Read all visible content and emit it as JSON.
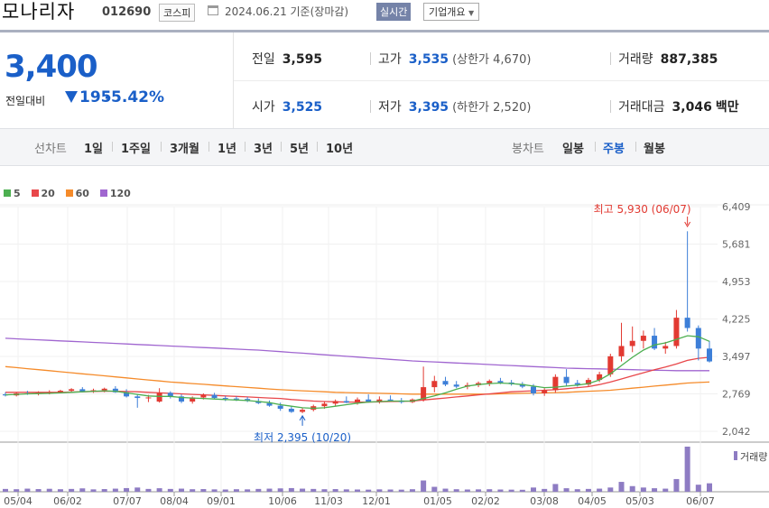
{
  "header": {
    "company": "모나리자",
    "code": "012690",
    "market": "코스피",
    "date": "2024.06.21 기준(장마감)",
    "realtime": "실시간",
    "company_info": "기업개요"
  },
  "price": {
    "current": "3,400",
    "change_label": "전일대비",
    "change": "195",
    "change_pct": "-5.42%"
  },
  "stats": {
    "prev_close_label": "전일",
    "prev_close": "3,595",
    "high_label": "고가",
    "high": "3,535",
    "upper_limit": "(상한가 4,670)",
    "volume_label": "거래량",
    "volume": "887,385",
    "open_label": "시가",
    "open": "3,525",
    "low_label": "저가",
    "low": "3,395",
    "lower_limit": "(하한가 2,520)",
    "amount_label": "거래대금",
    "amount": "3,046",
    "amount_unit": "백만"
  },
  "tabs": {
    "line_label": "선차트",
    "line_tabs": [
      "1일",
      "1주일",
      "3개월",
      "1년",
      "3년",
      "5년",
      "10년"
    ],
    "candle_label": "봉차트",
    "candle_tabs": [
      "일봉",
      "주봉",
      "월봉"
    ],
    "selected": "주봉"
  },
  "colors": {
    "up": "#e23a32",
    "down": "#3d7fd8",
    "ma5": "#4caf50",
    "ma20": "#e8474a",
    "ma60": "#f58b2a",
    "ma120": "#a066d0",
    "volume": "#8e7cc3",
    "accent": "#1a5fc8"
  },
  "chart_data": {
    "type": "candlestick",
    "legend": [
      {
        "name": "5",
        "color": "#4caf50"
      },
      {
        "name": "20",
        "color": "#e8474a"
      },
      {
        "name": "60",
        "color": "#f58b2a"
      },
      {
        "name": "120",
        "color": "#a066d0"
      }
    ],
    "y_ticks": [
      "6,409",
      "5,681",
      "4,953",
      "4,225",
      "3,497",
      "2,769",
      "2,042"
    ],
    "ylim": [
      2042,
      6409
    ],
    "x_ticks": [
      "05/04",
      "06/02",
      "07/07",
      "08/04",
      "09/01",
      "10/06",
      "11/03",
      "12/01",
      "01/05",
      "02/02",
      "03/08",
      "04/05",
      "05/03",
      "06/07"
    ],
    "annotations": {
      "high": {
        "label": "최고 5,930 (06/07)",
        "value": 5930
      },
      "low": {
        "label": "최저 2,395 (10/20)",
        "value": 2395
      }
    },
    "volume_label": "거래량",
    "candles": [
      {
        "o": 2760,
        "h": 2800,
        "l": 2720,
        "c": 2740
      },
      {
        "o": 2740,
        "h": 2800,
        "l": 2720,
        "c": 2780
      },
      {
        "o": 2780,
        "h": 2830,
        "l": 2750,
        "c": 2770
      },
      {
        "o": 2770,
        "h": 2820,
        "l": 2740,
        "c": 2790
      },
      {
        "o": 2790,
        "h": 2840,
        "l": 2760,
        "c": 2800
      },
      {
        "o": 2800,
        "h": 2850,
        "l": 2780,
        "c": 2830
      },
      {
        "o": 2830,
        "h": 2880,
        "l": 2790,
        "c": 2860
      },
      {
        "o": 2860,
        "h": 2900,
        "l": 2800,
        "c": 2820
      },
      {
        "o": 2820,
        "h": 2870,
        "l": 2790,
        "c": 2840
      },
      {
        "o": 2840,
        "h": 2890,
        "l": 2800,
        "c": 2870
      },
      {
        "o": 2870,
        "h": 2920,
        "l": 2790,
        "c": 2800
      },
      {
        "o": 2800,
        "h": 2860,
        "l": 2700,
        "c": 2720
      },
      {
        "o": 2720,
        "h": 2760,
        "l": 2500,
        "c": 2690
      },
      {
        "o": 2690,
        "h": 2750,
        "l": 2610,
        "c": 2700
      },
      {
        "o": 2620,
        "h": 2880,
        "l": 2600,
        "c": 2790
      },
      {
        "o": 2790,
        "h": 2820,
        "l": 2680,
        "c": 2720
      },
      {
        "o": 2720,
        "h": 2760,
        "l": 2590,
        "c": 2620
      },
      {
        "o": 2620,
        "h": 2720,
        "l": 2580,
        "c": 2700
      },
      {
        "o": 2700,
        "h": 2780,
        "l": 2660,
        "c": 2750
      },
      {
        "o": 2750,
        "h": 2790,
        "l": 2670,
        "c": 2690
      },
      {
        "o": 2690,
        "h": 2730,
        "l": 2630,
        "c": 2680
      },
      {
        "o": 2680,
        "h": 2720,
        "l": 2630,
        "c": 2670
      },
      {
        "o": 2670,
        "h": 2710,
        "l": 2610,
        "c": 2630
      },
      {
        "o": 2630,
        "h": 2680,
        "l": 2570,
        "c": 2590
      },
      {
        "o": 2590,
        "h": 2640,
        "l": 2520,
        "c": 2540
      },
      {
        "o": 2540,
        "h": 2600,
        "l": 2440,
        "c": 2480
      },
      {
        "o": 2480,
        "h": 2530,
        "l": 2400,
        "c": 2420
      },
      {
        "o": 2420,
        "h": 2500,
        "l": 2395,
        "c": 2460
      },
      {
        "o": 2460,
        "h": 2560,
        "l": 2430,
        "c": 2530
      },
      {
        "o": 2530,
        "h": 2620,
        "l": 2480,
        "c": 2580
      },
      {
        "o": 2580,
        "h": 2660,
        "l": 2540,
        "c": 2630
      },
      {
        "o": 2630,
        "h": 2720,
        "l": 2590,
        "c": 2600
      },
      {
        "o": 2600,
        "h": 2700,
        "l": 2560,
        "c": 2660
      },
      {
        "o": 2660,
        "h": 2760,
        "l": 2600,
        "c": 2620
      },
      {
        "o": 2620,
        "h": 2720,
        "l": 2580,
        "c": 2660
      },
      {
        "o": 2660,
        "h": 2740,
        "l": 2620,
        "c": 2640
      },
      {
        "o": 2640,
        "h": 2690,
        "l": 2580,
        "c": 2610
      },
      {
        "o": 2610,
        "h": 2680,
        "l": 2590,
        "c": 2660
      },
      {
        "o": 2660,
        "h": 3300,
        "l": 2620,
        "c": 2900
      },
      {
        "o": 2900,
        "h": 3120,
        "l": 2800,
        "c": 3020
      },
      {
        "o": 3020,
        "h": 3100,
        "l": 2920,
        "c": 2950
      },
      {
        "o": 2950,
        "h": 3020,
        "l": 2880,
        "c": 2910
      },
      {
        "o": 2910,
        "h": 2990,
        "l": 2860,
        "c": 2940
      },
      {
        "o": 2940,
        "h": 3010,
        "l": 2900,
        "c": 2980
      },
      {
        "o": 2980,
        "h": 3050,
        "l": 2920,
        "c": 3020
      },
      {
        "o": 3020,
        "h": 3080,
        "l": 2960,
        "c": 2990
      },
      {
        "o": 2990,
        "h": 3040,
        "l": 2930,
        "c": 2960
      },
      {
        "o": 2960,
        "h": 3000,
        "l": 2880,
        "c": 2910
      },
      {
        "o": 2910,
        "h": 2960,
        "l": 2740,
        "c": 2780
      },
      {
        "o": 2780,
        "h": 2880,
        "l": 2730,
        "c": 2840
      },
      {
        "o": 2840,
        "h": 3150,
        "l": 2790,
        "c": 3100
      },
      {
        "o": 3100,
        "h": 3250,
        "l": 2920,
        "c": 2980
      },
      {
        "o": 2980,
        "h": 3040,
        "l": 2910,
        "c": 2950
      },
      {
        "o": 2950,
        "h": 3080,
        "l": 2920,
        "c": 3040
      },
      {
        "o": 3040,
        "h": 3200,
        "l": 3000,
        "c": 3150
      },
      {
        "o": 3150,
        "h": 3550,
        "l": 3100,
        "c": 3500
      },
      {
        "o": 3500,
        "h": 4150,
        "l": 3400,
        "c": 3700
      },
      {
        "o": 3700,
        "h": 4080,
        "l": 3580,
        "c": 3800
      },
      {
        "o": 3800,
        "h": 4000,
        "l": 3650,
        "c": 3900
      },
      {
        "o": 3900,
        "h": 4050,
        "l": 3620,
        "c": 3650
      },
      {
        "o": 3650,
        "h": 3780,
        "l": 3550,
        "c": 3700
      },
      {
        "o": 3700,
        "h": 4400,
        "l": 3650,
        "c": 4250
      },
      {
        "o": 4250,
        "h": 5930,
        "l": 3980,
        "c": 4050
      },
      {
        "o": 4050,
        "h": 4100,
        "l": 3420,
        "c": 3650
      },
      {
        "o": 3650,
        "h": 3800,
        "l": 3380,
        "c": 3400
      }
    ],
    "ma5": [
      2750,
      2760,
      2770,
      2775,
      2780,
      2790,
      2800,
      2810,
      2820,
      2830,
      2820,
      2790,
      2760,
      2730,
      2720,
      2720,
      2700,
      2690,
      2680,
      2670,
      2660,
      2650,
      2640,
      2620,
      2600,
      2560,
      2530,
      2500,
      2490,
      2500,
      2530,
      2560,
      2590,
      2610,
      2620,
      2630,
      2630,
      2630,
      2680,
      2730,
      2790,
      2860,
      2920,
      2950,
      2970,
      2980,
      2970,
      2950,
      2920,
      2890,
      2900,
      2920,
      2940,
      2970,
      3040,
      3160,
      3320,
      3480,
      3620,
      3720,
      3760,
      3830,
      3900,
      3880,
      3790
    ],
    "ma20": [
      2800,
      2800,
      2800,
      2800,
      2800,
      2800,
      2805,
      2810,
      2815,
      2820,
      2820,
      2815,
      2810,
      2800,
      2790,
      2780,
      2770,
      2760,
      2750,
      2740,
      2730,
      2720,
      2710,
      2700,
      2690,
      2680,
      2660,
      2645,
      2630,
      2620,
      2615,
      2610,
      2610,
      2610,
      2615,
      2620,
      2625,
      2630,
      2650,
      2670,
      2690,
      2710,
      2730,
      2750,
      2770,
      2790,
      2810,
      2820,
      2830,
      2840,
      2850,
      2870,
      2890,
      2910,
      2950,
      3000,
      3060,
      3120,
      3180,
      3240,
      3290,
      3350,
      3420,
      3460,
      3480
    ],
    "ma60": [
      3300,
      3280,
      3260,
      3240,
      3220,
      3200,
      3180,
      3160,
      3140,
      3120,
      3100,
      3080,
      3060,
      3040,
      3020,
      3000,
      2985,
      2970,
      2955,
      2940,
      2925,
      2910,
      2895,
      2880,
      2865,
      2850,
      2840,
      2830,
      2820,
      2810,
      2800,
      2795,
      2790,
      2785,
      2780,
      2775,
      2770,
      2765,
      2765,
      2765,
      2765,
      2765,
      2765,
      2765,
      2765,
      2770,
      2775,
      2780,
      2785,
      2790,
      2795,
      2800,
      2810,
      2820,
      2830,
      2840,
      2860,
      2880,
      2900,
      2920,
      2940,
      2960,
      2980,
      2990,
      3000
    ],
    "ma120": [
      3850,
      3840,
      3830,
      3820,
      3810,
      3800,
      3790,
      3780,
      3770,
      3760,
      3750,
      3740,
      3730,
      3720,
      3710,
      3700,
      3690,
      3680,
      3670,
      3660,
      3650,
      3640,
      3630,
      3620,
      3605,
      3590,
      3575,
      3560,
      3545,
      3530,
      3515,
      3500,
      3485,
      3470,
      3455,
      3440,
      3425,
      3410,
      3400,
      3390,
      3380,
      3370,
      3360,
      3350,
      3340,
      3330,
      3320,
      3310,
      3300,
      3290,
      3280,
      3270,
      3265,
      3260,
      3255,
      3250,
      3245,
      3240,
      3235,
      3230,
      3225,
      3220,
      3220,
      3220,
      3220
    ],
    "volume": [
      20,
      18,
      22,
      19,
      21,
      18,
      20,
      24,
      17,
      19,
      22,
      26,
      30,
      20,
      25,
      20,
      22,
      18,
      19,
      17,
      16,
      18,
      17,
      20,
      22,
      24,
      26,
      22,
      20,
      18,
      19,
      17,
      16,
      15,
      17,
      16,
      15,
      18,
      80,
      35,
      22,
      18,
      16,
      17,
      18,
      16,
      15,
      14,
      30,
      20,
      55,
      25,
      18,
      20,
      22,
      30,
      70,
      40,
      30,
      25,
      22,
      90,
      320,
      50,
      60
    ]
  }
}
